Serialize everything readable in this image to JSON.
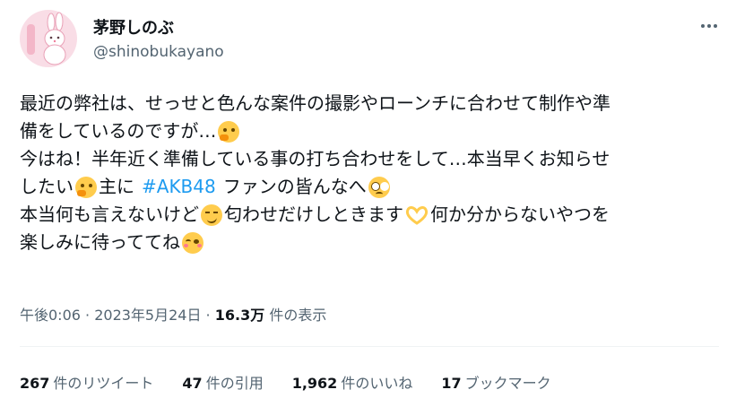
{
  "author": {
    "display_name": "茅野しのぶ",
    "handle": "@shinobukayano",
    "avatar_icon": "rabbit-avatar-icon"
  },
  "tweet": {
    "line1": "最近の弊社は、せっせと色んな案件の撮影やローンチに合わせて制作や準",
    "line2": "備をしているのですが…",
    "line3": "今はね！半年近く準備している事の打ち合わせをして…本当早くお知らせ",
    "line4_a": "したい",
    "line4_b": "主に",
    "hashtag": "#AKB48",
    "line4_c": "ファンの皆んなへ",
    "line5_a": "本当何も言えないけど",
    "line5_b": "匂わせだけしときます",
    "line5_c": "何か分からないやつを",
    "line6": "楽しみに待っててね"
  },
  "meta": {
    "time": "午後0:06",
    "sep": " · ",
    "date": "2023年5月24日",
    "views": "16.3万",
    "views_label": "件の表示"
  },
  "stats": [
    {
      "num": "267",
      "label": "件のリツイート"
    },
    {
      "num": "47",
      "label": "件の引用"
    },
    {
      "num": "1,962",
      "label": "件のいいね"
    },
    {
      "num": "17",
      "label": "ブックマーク"
    }
  ],
  "colors": {
    "hashtag": "#1d9bf0",
    "secondary_text": "#536471",
    "avatar_bg": "#f9dde6"
  }
}
